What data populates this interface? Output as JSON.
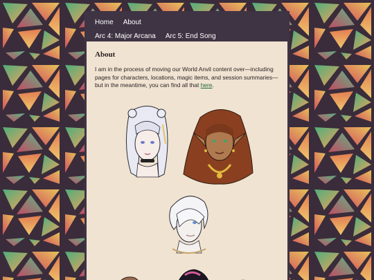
{
  "nav": {
    "row1": [
      "Home",
      "About"
    ],
    "row2": [
      "Arc 4: Major Arcana",
      "Arc 5: End Song"
    ]
  },
  "about": {
    "title": "About",
    "text_before": "I am in the process of moving our World Anvil content over—including pages for characters, locations, magic items, and session summaries—but in the meantime, you can find all that ",
    "link_text": "here",
    "text_after": "."
  },
  "colors": {
    "background_lead": "#3a2c3a",
    "nav_bar": "#3f3444",
    "content_panel": "#f0e3d1",
    "link": "#1d6b3b"
  }
}
